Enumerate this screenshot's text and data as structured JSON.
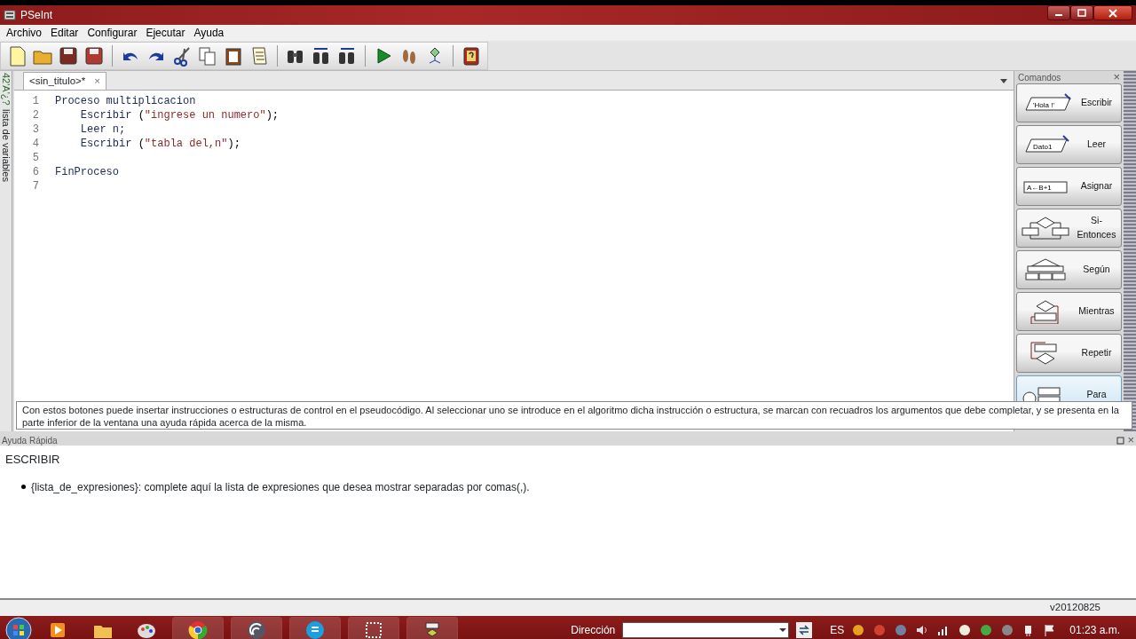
{
  "window": {
    "title": "PSeInt"
  },
  "menu": [
    "Archivo",
    "Editar",
    "Configurar",
    "Ejecutar",
    "Ayuda"
  ],
  "side_strip": {
    "symbols": "42'A'¿?",
    "label": "lista de variables"
  },
  "editor": {
    "tab": {
      "label": "<sin_titulo>*",
      "close": "×",
      "selected": true
    },
    "lines": [
      {
        "number": "1",
        "segments": [
          {
            "kind": "keyword",
            "text": "Proceso multiplicacion"
          }
        ]
      },
      {
        "number": "2",
        "segments": [
          {
            "kind": "keyword",
            "text": "    Escribir "
          },
          {
            "kind": "plain",
            "text": "("
          },
          {
            "kind": "string",
            "text": "\"ingrese un numero\""
          },
          {
            "kind": "plain",
            "text": ");"
          }
        ]
      },
      {
        "number": "3",
        "segments": [
          {
            "kind": "keyword",
            "text": "    Leer n;"
          }
        ]
      },
      {
        "number": "4",
        "segments": [
          {
            "kind": "keyword",
            "text": "    Escribir "
          },
          {
            "kind": "plain",
            "text": "("
          },
          {
            "kind": "string",
            "text": "\"tabla del,n\""
          },
          {
            "kind": "plain",
            "text": ");"
          }
        ]
      },
      {
        "number": "5"
      },
      {
        "number": "6",
        "segments": [
          {
            "kind": "keyword",
            "text": "FinProceso"
          }
        ]
      },
      {
        "number": "7"
      }
    ]
  },
  "commands": {
    "title": "Comandos",
    "close": "×",
    "items": [
      {
        "kind": "output",
        "label": "Escribir",
        "diagram_text": "'Hola !'",
        "selected": false
      },
      {
        "kind": "input",
        "label": "Leer",
        "diagram_text": "Dato1",
        "selected": false
      },
      {
        "kind": "assign",
        "label": "Asignar",
        "diagram_text": "A←B+1",
        "selected": false
      },
      {
        "kind": "if",
        "label": "Si-Entonces",
        "selected": false
      },
      {
        "kind": "switch",
        "label": "Según",
        "selected": false
      },
      {
        "kind": "while",
        "label": "Mientras",
        "selected": false
      },
      {
        "kind": "repeat",
        "label": "Repetir",
        "selected": false
      },
      {
        "kind": "for",
        "label": "Para",
        "selected": true
      }
    ]
  },
  "tooltip": "Con estos botones puede insertar instrucciones o estructuras de control en el pseudocódigo. Al seleccionar uno se introduce en el algoritmo dicha instrucción o estructura, se marcan con recuadros los argumentos que debe completar, y se presenta en la parte inferior de la ventana una ayuda rápida acerca de la misma.",
  "quick_help": {
    "title": "Ayuda Rápida",
    "close": "×",
    "heading": "ESCRIBIR",
    "bullets": [
      "{lista_de_expresiones}: complete aquí la lista de expresiones que desea mostrar separadas por comas(,)."
    ]
  },
  "status_bar": {
    "version": "v20120825"
  },
  "taskbar": {
    "address_label": "Dirección",
    "language": "ES",
    "time": "01:23 a.m."
  }
}
